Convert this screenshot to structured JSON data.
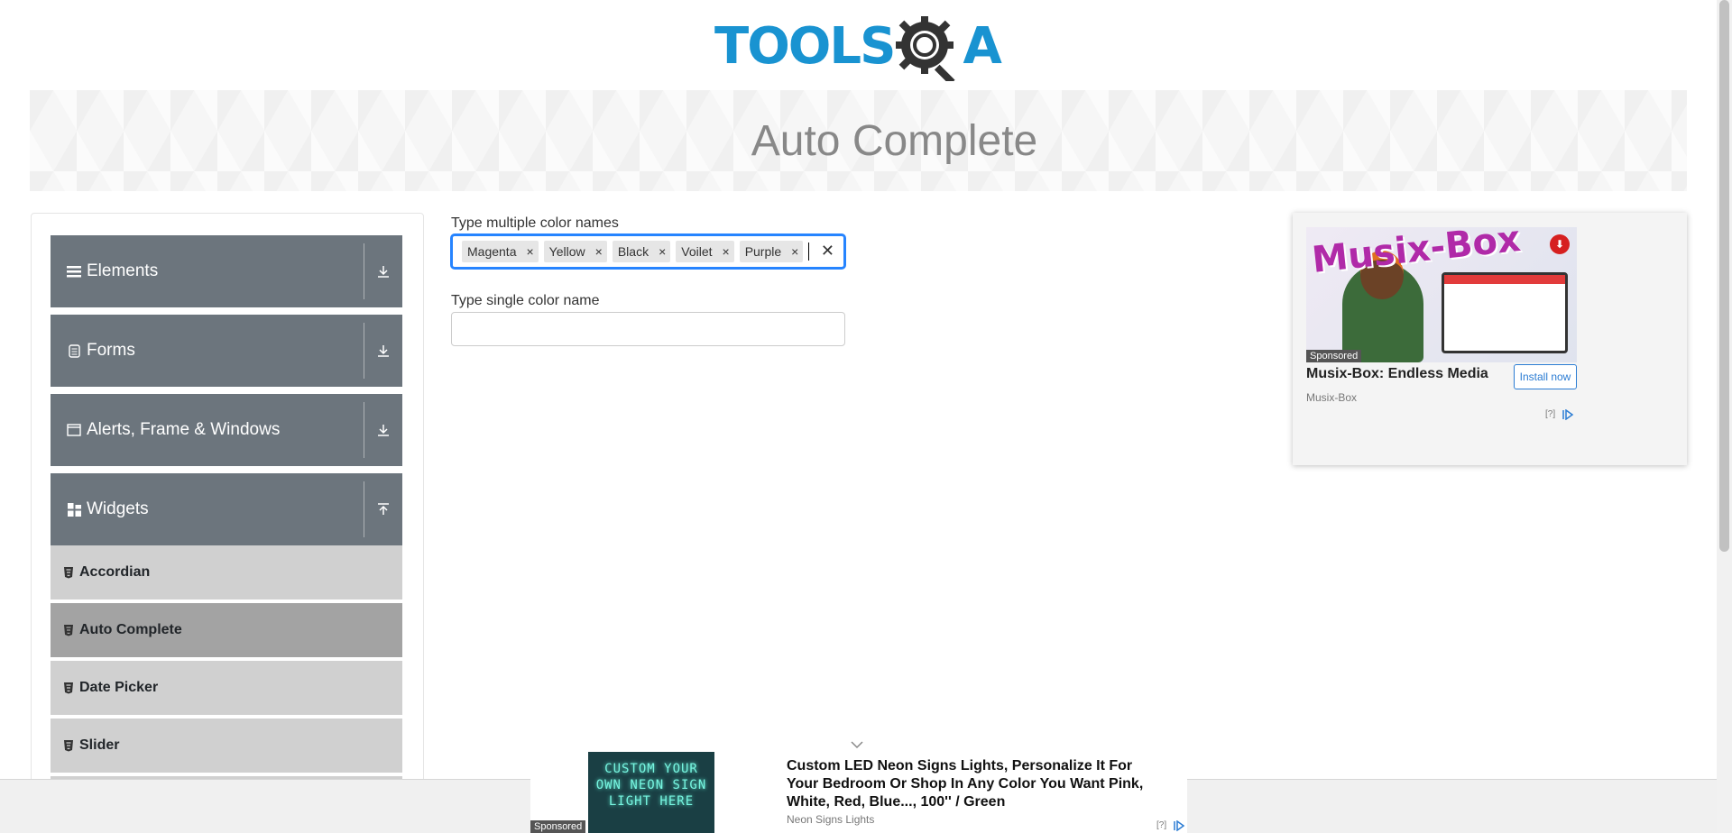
{
  "header": {
    "logo_left": "TOOLS",
    "logo_right": "A"
  },
  "banner": {
    "title": "Auto Complete"
  },
  "sidebar": {
    "groups": [
      {
        "label": "Elements",
        "icon": "menu-icon",
        "expanded": false
      },
      {
        "label": "Forms",
        "icon": "document-icon",
        "expanded": false
      },
      {
        "label": "Alerts, Frame & Windows",
        "icon": "window-icon",
        "expanded": false
      },
      {
        "label": "Widgets",
        "icon": "grid-icon",
        "expanded": true
      }
    ],
    "widget_items": [
      {
        "label": "Accordian",
        "active": false
      },
      {
        "label": "Auto Complete",
        "active": true
      },
      {
        "label": "Date Picker",
        "active": false
      },
      {
        "label": "Slider",
        "active": false
      }
    ]
  },
  "form": {
    "multi_label": "Type multiple color names",
    "chips": [
      {
        "label": "Magenta",
        "remove": "×"
      },
      {
        "label": "Yellow",
        "remove": "×"
      },
      {
        "label": "Black",
        "remove": "×"
      },
      {
        "label": "Voilet",
        "remove": "×"
      },
      {
        "label": "Purple",
        "remove": "×"
      }
    ],
    "clear": "✕",
    "single_label": "Type single color name",
    "single_value": ""
  },
  "ad_right": {
    "brand": "Musix-Box",
    "sponsored": "Sponsored",
    "title": "Musix-Box: Endless Media",
    "source": "Musix-Box",
    "button": "Install now",
    "info": "[?]"
  },
  "ad_bottom": {
    "image_text": "CUSTOM YOUR OWN NEON SIGN LIGHT HERE",
    "sponsored": "Sponsored",
    "title": "Custom LED Neon Signs Lights, Personalize It For Your Bedroom Or Shop In Any Color You Want Pink, White, Red, Blue..., 100'' / Green",
    "source": "Neon Signs Lights",
    "info": "[?]"
  },
  "colors": {
    "brand_blue": "#1993d1",
    "sidebar_gray": "#6c757d",
    "focus_blue": "#2684ff"
  }
}
